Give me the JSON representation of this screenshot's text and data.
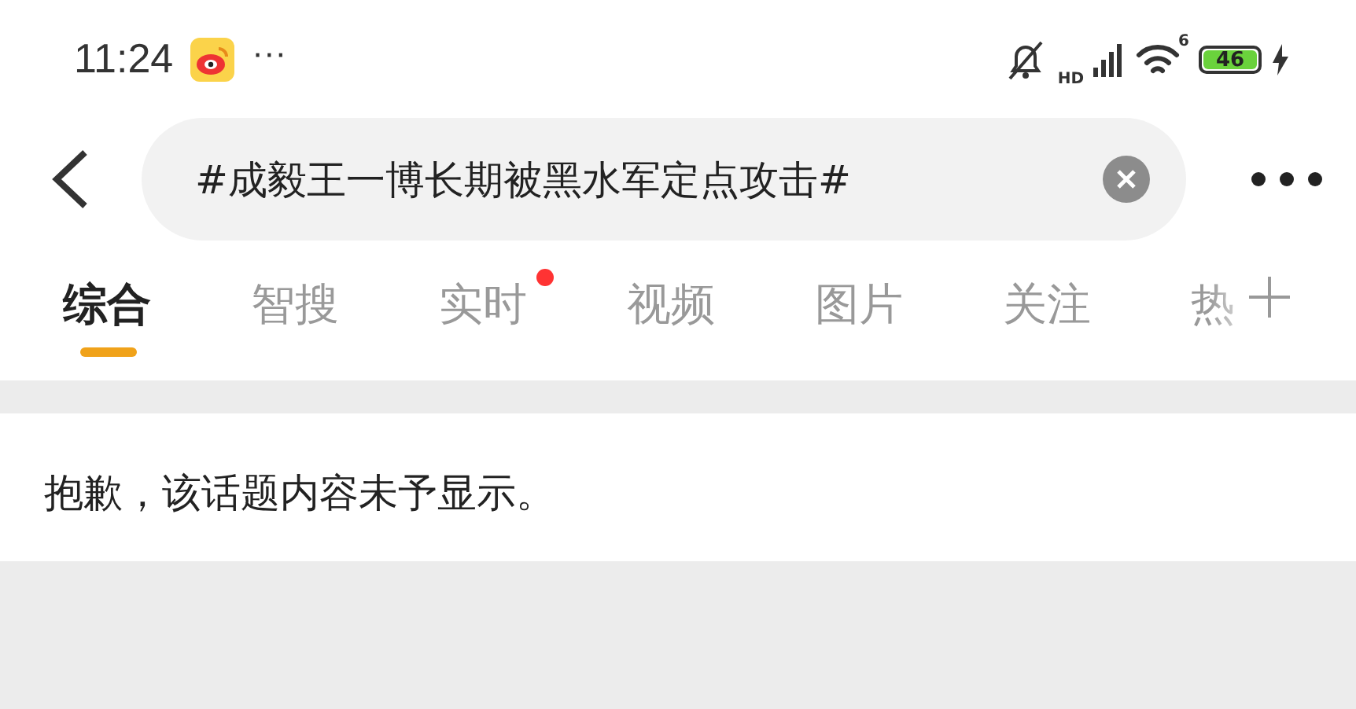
{
  "status_bar": {
    "time": "11:24",
    "more": "···",
    "network_type": "HD",
    "wifi_generation": "6",
    "battery": "46",
    "charging": true,
    "muted": true
  },
  "search": {
    "value": "#成毅王一博长期被黑水军定点攻击#"
  },
  "tabs": [
    {
      "label": "综合",
      "selected": true,
      "badge": false
    },
    {
      "label": "智搜",
      "selected": false,
      "badge": false
    },
    {
      "label": "实时",
      "selected": false,
      "badge": true
    },
    {
      "label": "视频",
      "selected": false,
      "badge": false
    },
    {
      "label": "图片",
      "selected": false,
      "badge": false
    },
    {
      "label": "关注",
      "selected": false,
      "badge": false
    },
    {
      "label": "热",
      "selected": false,
      "badge": false
    }
  ],
  "notice": "抱歉，该话题内容未予显示。"
}
